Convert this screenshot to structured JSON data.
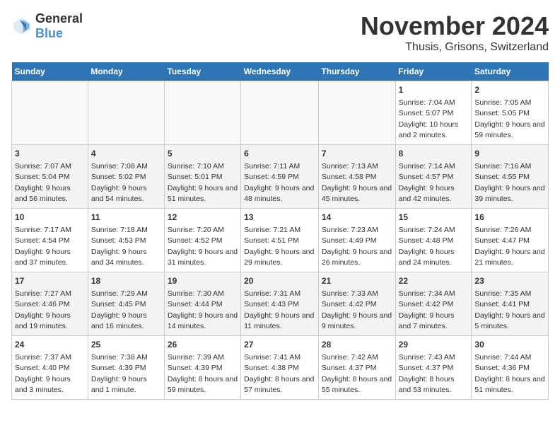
{
  "logo": {
    "general": "General",
    "blue": "Blue"
  },
  "header": {
    "month": "November 2024",
    "location": "Thusis, Grisons, Switzerland"
  },
  "weekdays": [
    "Sunday",
    "Monday",
    "Tuesday",
    "Wednesday",
    "Thursday",
    "Friday",
    "Saturday"
  ],
  "weeks": [
    [
      {
        "day": "",
        "info": ""
      },
      {
        "day": "",
        "info": ""
      },
      {
        "day": "",
        "info": ""
      },
      {
        "day": "",
        "info": ""
      },
      {
        "day": "",
        "info": ""
      },
      {
        "day": "1",
        "info": "Sunrise: 7:04 AM\nSunset: 5:07 PM\nDaylight: 10 hours and 2 minutes."
      },
      {
        "day": "2",
        "info": "Sunrise: 7:05 AM\nSunset: 5:05 PM\nDaylight: 9 hours and 59 minutes."
      }
    ],
    [
      {
        "day": "3",
        "info": "Sunrise: 7:07 AM\nSunset: 5:04 PM\nDaylight: 9 hours and 56 minutes."
      },
      {
        "day": "4",
        "info": "Sunrise: 7:08 AM\nSunset: 5:02 PM\nDaylight: 9 hours and 54 minutes."
      },
      {
        "day": "5",
        "info": "Sunrise: 7:10 AM\nSunset: 5:01 PM\nDaylight: 9 hours and 51 minutes."
      },
      {
        "day": "6",
        "info": "Sunrise: 7:11 AM\nSunset: 4:59 PM\nDaylight: 9 hours and 48 minutes."
      },
      {
        "day": "7",
        "info": "Sunrise: 7:13 AM\nSunset: 4:58 PM\nDaylight: 9 hours and 45 minutes."
      },
      {
        "day": "8",
        "info": "Sunrise: 7:14 AM\nSunset: 4:57 PM\nDaylight: 9 hours and 42 minutes."
      },
      {
        "day": "9",
        "info": "Sunrise: 7:16 AM\nSunset: 4:55 PM\nDaylight: 9 hours and 39 minutes."
      }
    ],
    [
      {
        "day": "10",
        "info": "Sunrise: 7:17 AM\nSunset: 4:54 PM\nDaylight: 9 hours and 37 minutes."
      },
      {
        "day": "11",
        "info": "Sunrise: 7:18 AM\nSunset: 4:53 PM\nDaylight: 9 hours and 34 minutes."
      },
      {
        "day": "12",
        "info": "Sunrise: 7:20 AM\nSunset: 4:52 PM\nDaylight: 9 hours and 31 minutes."
      },
      {
        "day": "13",
        "info": "Sunrise: 7:21 AM\nSunset: 4:51 PM\nDaylight: 9 hours and 29 minutes."
      },
      {
        "day": "14",
        "info": "Sunrise: 7:23 AM\nSunset: 4:49 PM\nDaylight: 9 hours and 26 minutes."
      },
      {
        "day": "15",
        "info": "Sunrise: 7:24 AM\nSunset: 4:48 PM\nDaylight: 9 hours and 24 minutes."
      },
      {
        "day": "16",
        "info": "Sunrise: 7:26 AM\nSunset: 4:47 PM\nDaylight: 9 hours and 21 minutes."
      }
    ],
    [
      {
        "day": "17",
        "info": "Sunrise: 7:27 AM\nSunset: 4:46 PM\nDaylight: 9 hours and 19 minutes."
      },
      {
        "day": "18",
        "info": "Sunrise: 7:29 AM\nSunset: 4:45 PM\nDaylight: 9 hours and 16 minutes."
      },
      {
        "day": "19",
        "info": "Sunrise: 7:30 AM\nSunset: 4:44 PM\nDaylight: 9 hours and 14 minutes."
      },
      {
        "day": "20",
        "info": "Sunrise: 7:31 AM\nSunset: 4:43 PM\nDaylight: 9 hours and 11 minutes."
      },
      {
        "day": "21",
        "info": "Sunrise: 7:33 AM\nSunset: 4:42 PM\nDaylight: 9 hours and 9 minutes."
      },
      {
        "day": "22",
        "info": "Sunrise: 7:34 AM\nSunset: 4:42 PM\nDaylight: 9 hours and 7 minutes."
      },
      {
        "day": "23",
        "info": "Sunrise: 7:35 AM\nSunset: 4:41 PM\nDaylight: 9 hours and 5 minutes."
      }
    ],
    [
      {
        "day": "24",
        "info": "Sunrise: 7:37 AM\nSunset: 4:40 PM\nDaylight: 9 hours and 3 minutes."
      },
      {
        "day": "25",
        "info": "Sunrise: 7:38 AM\nSunset: 4:39 PM\nDaylight: 9 hours and 1 minute."
      },
      {
        "day": "26",
        "info": "Sunrise: 7:39 AM\nSunset: 4:39 PM\nDaylight: 8 hours and 59 minutes."
      },
      {
        "day": "27",
        "info": "Sunrise: 7:41 AM\nSunset: 4:38 PM\nDaylight: 8 hours and 57 minutes."
      },
      {
        "day": "28",
        "info": "Sunrise: 7:42 AM\nSunset: 4:37 PM\nDaylight: 8 hours and 55 minutes."
      },
      {
        "day": "29",
        "info": "Sunrise: 7:43 AM\nSunset: 4:37 PM\nDaylight: 8 hours and 53 minutes."
      },
      {
        "day": "30",
        "info": "Sunrise: 7:44 AM\nSunset: 4:36 PM\nDaylight: 8 hours and 51 minutes."
      }
    ]
  ]
}
